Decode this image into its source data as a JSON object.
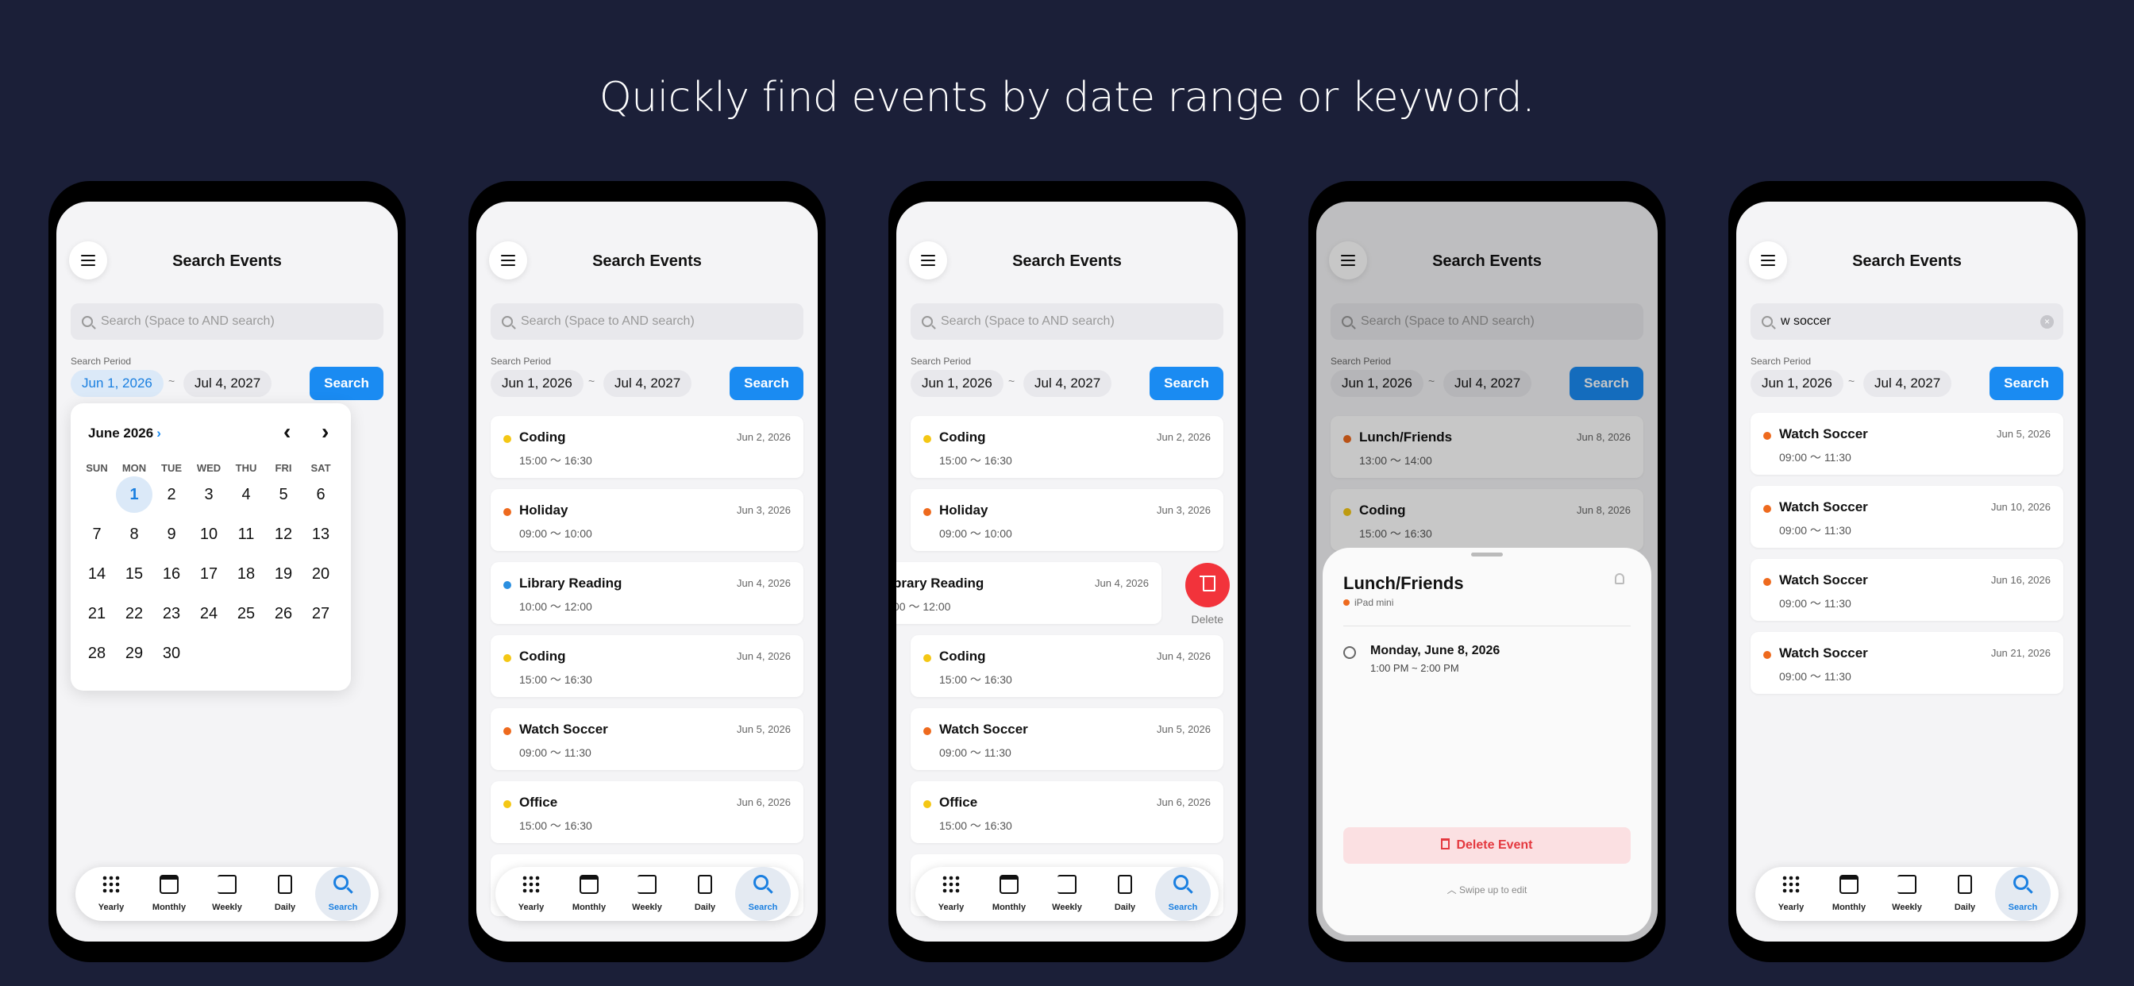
{
  "headline": "Quickly find events by date range or keyword.",
  "common": {
    "title": "Search Events",
    "placeholder": "Search (Space to AND search)",
    "period_label": "Search Period",
    "start": "Jun 1, 2026",
    "end": "Jul 4, 2027",
    "tilde": "~",
    "search_btn": "Search",
    "tabs": [
      "Yearly",
      "Monthly",
      "Weekly",
      "Daily",
      "Search"
    ]
  },
  "colors": {
    "accent": "#1a8bf2",
    "orange": "#ee6a1e",
    "yellow": "#f4c715",
    "blue": "#2b8fe0",
    "danger": "#e4393f"
  },
  "calendar": {
    "month": "June 2026",
    "weekdays": [
      "SUN",
      "MON",
      "TUE",
      "WED",
      "THU",
      "FRI",
      "SAT"
    ],
    "days": [
      "1",
      "2",
      "3",
      "4",
      "5",
      "6",
      "7",
      "8",
      "9",
      "10",
      "11",
      "12",
      "13",
      "14",
      "15",
      "16",
      "17",
      "18",
      "19",
      "20",
      "21",
      "22",
      "23",
      "24",
      "25",
      "26",
      "27",
      "28",
      "29",
      "30"
    ]
  },
  "list": [
    {
      "name": "Coding",
      "time": "15:00 〜 16:30",
      "date": "Jun 2, 2026",
      "color": "#f4c715"
    },
    {
      "name": "Holiday",
      "time": "09:00 〜 10:00",
      "date": "Jun 3, 2026",
      "color": "#ee6a1e"
    },
    {
      "name": "Library Reading",
      "time": "10:00 〜 12:00",
      "date": "Jun 4, 2026",
      "color": "#2b8fe0"
    },
    {
      "name": "Coding",
      "time": "15:00 〜 16:30",
      "date": "Jun 4, 2026",
      "color": "#f4c715"
    },
    {
      "name": "Watch Soccer",
      "time": "09:00 〜 11:30",
      "date": "Jun 5, 2026",
      "color": "#ee6a1e"
    },
    {
      "name": "Office",
      "time": "15:00 〜 16:30",
      "date": "Jun 6, 2026",
      "color": "#f4c715"
    }
  ],
  "swipe": {
    "name_partial": "brary Reading",
    "time_partial": "00 〜 12:00",
    "date": "Jun 4, 2026",
    "delete": "Delete"
  },
  "detail_list": [
    {
      "name": "Lunch/Friends",
      "time": "13:00 〜 14:00",
      "date": "Jun 8, 2026",
      "color": "#ee6a1e"
    },
    {
      "name": "Coding",
      "time": "15:00 〜 16:30",
      "date": "Jun 8, 2026",
      "color": "#f4c715"
    }
  ],
  "detail": {
    "title": "Lunch/Friends",
    "calendar": "iPad mini",
    "date": "Monday, June 8, 2026",
    "time": "1:00 PM ~ 2:00 PM",
    "delete_btn": "Delete Event",
    "hint": "Swipe up to edit"
  },
  "keyword": {
    "query": "w soccer",
    "results": [
      {
        "name": "Watch Soccer",
        "time": "09:00 〜 11:30",
        "date": "Jun 5, 2026",
        "color": "#ee6a1e"
      },
      {
        "name": "Watch Soccer",
        "time": "09:00 〜 11:30",
        "date": "Jun 10, 2026",
        "color": "#ee6a1e"
      },
      {
        "name": "Watch Soccer",
        "time": "09:00 〜 11:30",
        "date": "Jun 16, 2026",
        "color": "#ee6a1e"
      },
      {
        "name": "Watch Soccer",
        "time": "09:00 〜 11:30",
        "date": "Jun 21, 2026",
        "color": "#ee6a1e"
      }
    ]
  }
}
